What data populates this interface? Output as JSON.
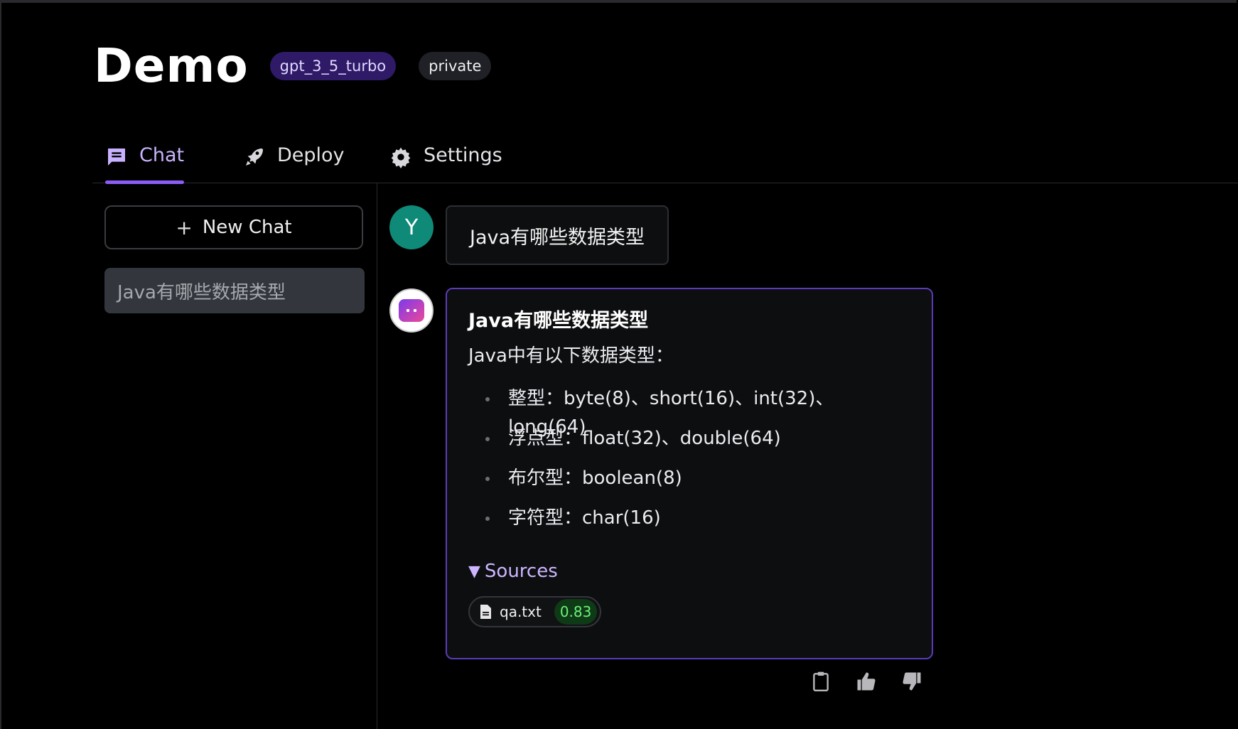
{
  "header": {
    "title": "Demo",
    "model_badge": "gpt_3_5_turbo",
    "visibility_badge": "private"
  },
  "tabs": [
    {
      "label": "Chat",
      "icon": "chat-icon",
      "active": true
    },
    {
      "label": "Deploy",
      "icon": "rocket-icon",
      "active": false
    },
    {
      "label": "Settings",
      "icon": "gear-icon",
      "active": false
    }
  ],
  "sidebar": {
    "new_chat_label": "New Chat",
    "new_chat_icon": "+",
    "history": [
      {
        "label": "Java有哪些数据类型",
        "selected": true
      }
    ]
  },
  "conversation": {
    "user": {
      "avatar_letter": "Y",
      "message": "Java有哪些数据类型"
    },
    "assistant": {
      "title": "Java有哪些数据类型",
      "intro": "Java中有以下数据类型：",
      "items": [
        "整型：byte(8)、short(16)、int(32)、long(64)",
        "浮点型：float(32)、double(64)",
        "布尔型：boolean(8)",
        "字符型：char(16)"
      ],
      "sources_label": "Sources",
      "sources": [
        {
          "file": "qa.txt",
          "score": "0.83",
          "icon": "file-icon"
        }
      ]
    }
  },
  "actions": [
    "clipboard-icon",
    "thumbs-up-icon",
    "thumbs-down-icon"
  ],
  "colors": {
    "background": "#000000",
    "accent": "#8b5cf6",
    "active_tab_text": "#c8b2ff",
    "model_badge_bg": "#2e1a66",
    "user_avatar_bg": "#0f8a78",
    "score_text": "#6bf07a"
  }
}
